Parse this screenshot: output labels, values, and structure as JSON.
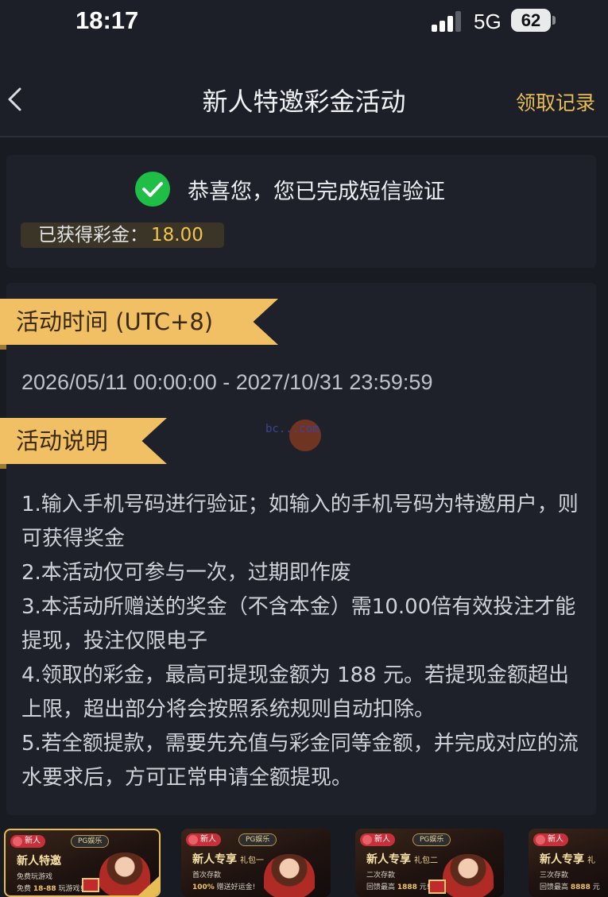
{
  "status_bar": {
    "time": "18:17",
    "network": "5G",
    "battery": "62"
  },
  "nav": {
    "title": "新人特邀彩金活动",
    "record_link": "领取记录"
  },
  "verify": {
    "message": "恭喜您，您已完成短信验证",
    "bonus_label": "已获得彩金：",
    "bonus_value": "18.00"
  },
  "activity": {
    "time_heading": "活动时间 (UTC+8)",
    "time_range": "2026/05/11 00:00:00 - 2027/10/31 23:59:59",
    "desc_heading": "活动说明",
    "watermark": "bc...com",
    "items": [
      "1.输入手机号码进行验证；如输入的手机号码为特邀用户，则可获得奖金",
      "2.本活动仅可参与一次，过期即作废",
      "3.本活动所赠送的奖金（不含本金）需10.00倍有效投注才能提现，投注仅限电子",
      "4.领取的彩金，最高可提现金额为 188 元。若提现金额超出上限，超出部分将会按照系统规则自动扣除。",
      "5.若全额提款，需要先充值与彩金同等金额，并完成对应的流水要求后，方可正常申请全额提现。"
    ]
  },
  "promos": [
    {
      "badge": "新人",
      "pg": "PG娱乐",
      "title": "新人特邀",
      "sub": "",
      "line1": "免费玩游戏",
      "line2_prefix": "免费 ",
      "line2_value": "18-88",
      "line2_suffix": " 玩游戏!"
    },
    {
      "badge": "新人",
      "pg": "PG娱乐",
      "title": "新人专享",
      "sub": "礼包一",
      "line1": "首次存款",
      "line2_prefix": "",
      "line2_value": "100%",
      "line2_suffix": " 赠送好运金!"
    },
    {
      "badge": "新人",
      "pg": "PG娱乐",
      "title": "新人专享",
      "sub": "礼包二",
      "line1": "二次存款",
      "line2_prefix": "回馈最高 ",
      "line2_value": "1888",
      "line2_suffix": " 元!"
    },
    {
      "badge": "新人",
      "pg": "PG娱乐",
      "title": "新人专享",
      "sub": "礼",
      "line1": "三次存款",
      "line2_prefix": "回馈最高 ",
      "line2_value": "8888",
      "line2_suffix": " 元"
    }
  ]
}
